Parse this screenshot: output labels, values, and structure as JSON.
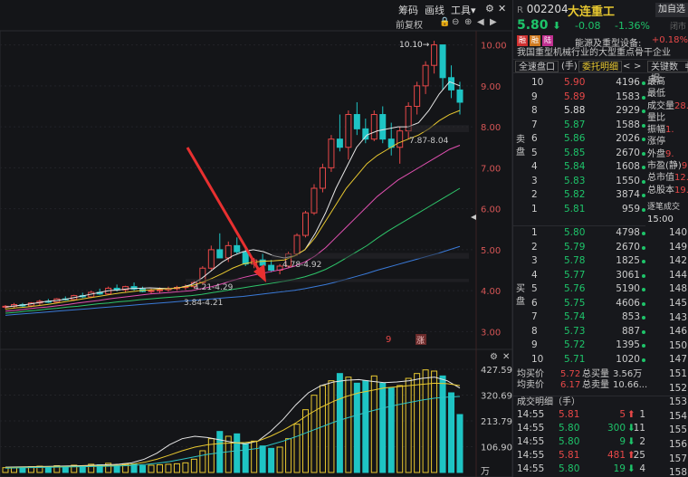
{
  "toolbar": {
    "chip_label": "筹码",
    "draw_label": "画线",
    "tools_label": "工具",
    "adjust_label": "前复权"
  },
  "chart_data": {
    "type": "candlestick",
    "price_ticks": [
      "10.00",
      "9.00",
      "8.00",
      "7.00",
      "6.00",
      "5.00",
      "4.00",
      "3.00"
    ],
    "price_range": [
      2.7,
      10.3
    ],
    "volume_ticks": [
      "427.59",
      "320.69",
      "213.79",
      "106.90",
      "万"
    ],
    "annotations": [
      "10.10→",
      "7.87-8.04",
      "4.78-4.92",
      "4.21-4.29",
      "3.84-4.21"
    ],
    "bottom_marks": [
      "9",
      "涨"
    ],
    "candles": [
      [
        3.6,
        3.65,
        3.55,
        3.62
      ],
      [
        3.62,
        3.7,
        3.58,
        3.66
      ],
      [
        3.66,
        3.7,
        3.6,
        3.63
      ],
      [
        3.63,
        3.72,
        3.6,
        3.7
      ],
      [
        3.7,
        3.78,
        3.65,
        3.74
      ],
      [
        3.74,
        3.8,
        3.7,
        3.72
      ],
      [
        3.72,
        3.82,
        3.7,
        3.8
      ],
      [
        3.8,
        3.86,
        3.76,
        3.78
      ],
      [
        3.78,
        3.9,
        3.75,
        3.88
      ],
      [
        3.88,
        3.95,
        3.82,
        3.85
      ],
      [
        3.85,
        4.0,
        3.82,
        3.96
      ],
      [
        3.96,
        4.05,
        3.9,
        3.92
      ],
      [
        3.92,
        4.1,
        3.9,
        4.06
      ],
      [
        4.06,
        4.15,
        3.98,
        4.02
      ],
      [
        4.02,
        4.12,
        3.95,
        4.1
      ],
      [
        4.1,
        4.2,
        4.0,
        4.04
      ],
      [
        4.04,
        4.1,
        3.96,
        3.98
      ],
      [
        3.98,
        4.05,
        3.92,
        4.0
      ],
      [
        4.0,
        4.08,
        3.95,
        4.02
      ],
      [
        4.02,
        4.1,
        3.98,
        4.05
      ],
      [
        4.05,
        4.12,
        4.0,
        4.08
      ],
      [
        4.08,
        4.15,
        4.02,
        4.1
      ],
      [
        4.1,
        4.25,
        4.05,
        4.2
      ],
      [
        4.2,
        4.6,
        4.15,
        4.55
      ],
      [
        4.55,
        5.1,
        4.5,
        5.0
      ],
      [
        5.0,
        5.4,
        4.9,
        4.8
      ],
      [
        4.8,
        5.2,
        4.7,
        5.1
      ],
      [
        5.1,
        5.3,
        4.9,
        4.95
      ],
      [
        4.95,
        5.05,
        4.6,
        4.65
      ],
      [
        4.65,
        4.8,
        4.55,
        4.75
      ],
      [
        4.75,
        4.9,
        4.6,
        4.62
      ],
      [
        4.62,
        4.75,
        4.45,
        4.5
      ],
      [
        4.5,
        4.65,
        4.4,
        4.6
      ],
      [
        4.6,
        4.95,
        4.55,
        4.9
      ],
      [
        4.9,
        5.4,
        4.85,
        5.35
      ],
      [
        5.35,
        5.95,
        5.3,
        5.9
      ],
      [
        5.9,
        6.6,
        5.85,
        6.5
      ],
      [
        6.5,
        7.1,
        6.4,
        7.0
      ],
      [
        7.0,
        7.8,
        6.9,
        7.7
      ],
      [
        7.7,
        8.3,
        7.4,
        7.5
      ],
      [
        7.5,
        8.4,
        7.2,
        8.3
      ],
      [
        8.3,
        8.6,
        7.8,
        7.95
      ],
      [
        7.95,
        8.2,
        7.6,
        7.7
      ],
      [
        7.7,
        8.4,
        7.65,
        8.3
      ],
      [
        8.3,
        8.5,
        7.6,
        7.7
      ],
      [
        7.7,
        8.1,
        7.3,
        7.5
      ],
      [
        7.5,
        8.0,
        7.1,
        7.9
      ],
      [
        7.9,
        8.6,
        7.7,
        8.5
      ],
      [
        8.5,
        9.1,
        8.3,
        9.0
      ],
      [
        9.0,
        9.6,
        8.8,
        9.5
      ],
      [
        9.5,
        10.1,
        9.3,
        10.0
      ],
      [
        10.0,
        10.0,
        8.9,
        9.2
      ],
      [
        9.2,
        9.5,
        8.7,
        8.9
      ],
      [
        8.9,
        9.1,
        8.3,
        8.6
      ]
    ],
    "ma_lines": [
      {
        "color": "#e6e6e6",
        "values": [
          3.6,
          3.63,
          3.66,
          3.7,
          3.74,
          3.76,
          3.8,
          3.85,
          3.9,
          3.95,
          4.0,
          4.02,
          4.05,
          4.06,
          4.07,
          4.06,
          4.05,
          4.08,
          4.15,
          4.3,
          4.5,
          4.7,
          4.85,
          4.95,
          5.0,
          4.95,
          4.85,
          4.8,
          4.85,
          5.0,
          5.4,
          5.9,
          6.5,
          7.0,
          7.5,
          7.8,
          7.9,
          7.95,
          8.0,
          8.0,
          8.1,
          8.4,
          8.8,
          9.1,
          9.0
        ]
      },
      {
        "color": "#e8c830",
        "values": [
          3.55,
          3.58,
          3.6,
          3.63,
          3.66,
          3.7,
          3.74,
          3.78,
          3.82,
          3.86,
          3.9,
          3.94,
          3.97,
          4.0,
          4.02,
          4.04,
          4.05,
          4.08,
          4.12,
          4.2,
          4.3,
          4.42,
          4.55,
          4.65,
          4.7,
          4.72,
          4.73,
          4.75,
          4.85,
          5.0,
          5.3,
          5.7,
          6.1,
          6.5,
          6.8,
          7.1,
          7.3,
          7.45,
          7.6,
          7.7,
          7.8,
          7.95,
          8.15,
          8.3,
          8.4
        ]
      },
      {
        "color": "#e050b0",
        "values": [
          3.5,
          3.52,
          3.55,
          3.58,
          3.6,
          3.63,
          3.66,
          3.7,
          3.73,
          3.76,
          3.8,
          3.83,
          3.86,
          3.89,
          3.92,
          3.94,
          3.96,
          3.98,
          4.0,
          4.05,
          4.1,
          4.17,
          4.25,
          4.32,
          4.38,
          4.43,
          4.48,
          4.53,
          4.6,
          4.7,
          4.85,
          5.05,
          5.3,
          5.55,
          5.8,
          6.05,
          6.3,
          6.5,
          6.7,
          6.85,
          7.0,
          7.15,
          7.3,
          7.45,
          7.55
        ]
      },
      {
        "color": "#2ec46a",
        "values": [
          3.45,
          3.47,
          3.5,
          3.52,
          3.55,
          3.57,
          3.6,
          3.62,
          3.65,
          3.68,
          3.7,
          3.73,
          3.75,
          3.78,
          3.8,
          3.82,
          3.84,
          3.86,
          3.88,
          3.91,
          3.95,
          3.99,
          4.03,
          4.07,
          4.11,
          4.15,
          4.19,
          4.23,
          4.28,
          4.34,
          4.42,
          4.52,
          4.65,
          4.8,
          4.95,
          5.1,
          5.28,
          5.45,
          5.6,
          5.75,
          5.9,
          6.05,
          6.2,
          6.35,
          6.5
        ]
      },
      {
        "color": "#3a7ad8",
        "values": [
          3.4,
          3.42,
          3.44,
          3.46,
          3.48,
          3.5,
          3.52,
          3.54,
          3.56,
          3.58,
          3.6,
          3.62,
          3.64,
          3.66,
          3.68,
          3.7,
          3.72,
          3.74,
          3.76,
          3.78,
          3.8,
          3.82,
          3.84,
          3.86,
          3.89,
          3.92,
          3.95,
          3.98,
          4.01,
          4.05,
          4.1,
          4.15,
          4.21,
          4.28,
          4.35,
          4.42,
          4.5,
          4.57,
          4.64,
          4.71,
          4.78,
          4.85,
          4.92,
          5.0,
          5.08
        ]
      }
    ],
    "volumes": [
      20,
      22,
      18,
      24,
      26,
      22,
      28,
      25,
      30,
      27,
      34,
      32,
      38,
      30,
      36,
      35,
      28,
      30,
      32,
      34,
      36,
      40,
      55,
      90,
      140,
      170,
      150,
      160,
      120,
      130,
      110,
      100,
      105,
      140,
      200,
      260,
      320,
      360,
      380,
      410,
      395,
      370,
      380,
      400,
      370,
      350,
      360,
      390,
      410,
      425,
      420,
      400,
      330,
      240
    ],
    "vol_ma": [
      {
        "color": "#e6e6e6",
        "values": [
          22,
          23,
          24,
          25,
          26,
          27,
          28,
          30,
          32,
          34,
          40,
          55,
          80,
          115,
          140,
          150,
          145,
          135,
          125,
          118,
          130,
          170,
          220,
          280,
          330,
          360,
          375,
          382,
          385,
          378,
          372,
          375,
          380,
          390,
          395,
          380,
          350
        ]
      },
      {
        "color": "#e8c830",
        "values": [
          20,
          21,
          22,
          23,
          24,
          25,
          26,
          27,
          28,
          30,
          34,
          42,
          55,
          72,
          90,
          105,
          115,
          120,
          122,
          124,
          130,
          150,
          175,
          205,
          240,
          270,
          295,
          315,
          330,
          340,
          350,
          355,
          360,
          365,
          370,
          368,
          360
        ]
      },
      {
        "color": "#2ec4c4",
        "values": [
          18,
          19,
          20,
          21,
          22,
          23,
          24,
          25,
          26,
          27,
          29,
          33,
          38,
          45,
          55,
          65,
          75,
          82,
          88,
          93,
          100,
          115,
          130,
          148,
          168,
          188,
          208,
          225,
          240,
          255,
          268,
          280,
          290,
          300,
          308,
          312,
          315
        ]
      }
    ]
  },
  "quote": {
    "r_label": "R",
    "code": "002204",
    "name": "大连重工",
    "add_label": "加自选",
    "price": "5.80",
    "arrow": "⬇",
    "change": "-0.08",
    "pct": "-1.36%",
    "status": "闭市",
    "tags": [
      "融",
      "融",
      "陆"
    ],
    "industry": "能源及重型设备:",
    "industry_change": "+0.18%",
    "desc": "我国重型机械行业的大型重点骨干企业",
    "tabs": [
      "全速盘口",
      "(手)",
      "委托明细",
      "<",
      ">",
      "关键数据",
      "≡"
    ],
    "sell_label": "卖盘",
    "buy_label": "买盘",
    "asks": [
      {
        "lv": "10",
        "p": "5.90",
        "v": "4196"
      },
      {
        "lv": "9",
        "p": "5.89",
        "v": "1583"
      },
      {
        "lv": "8",
        "p": "5.88",
        "v": "2929"
      },
      {
        "lv": "7",
        "p": "5.87",
        "v": "1588"
      },
      {
        "lv": "6",
        "p": "5.86",
        "v": "2026"
      },
      {
        "lv": "5",
        "p": "5.85",
        "v": "2670"
      },
      {
        "lv": "4",
        "p": "5.84",
        "v": "1608"
      },
      {
        "lv": "3",
        "p": "5.83",
        "v": "1550"
      },
      {
        "lv": "2",
        "p": "5.82",
        "v": "3874"
      },
      {
        "lv": "1",
        "p": "5.81",
        "v": "959"
      }
    ],
    "bids": [
      {
        "lv": "1",
        "p": "5.80",
        "v": "4798"
      },
      {
        "lv": "2",
        "p": "5.79",
        "v": "2670"
      },
      {
        "lv": "3",
        "p": "5.78",
        "v": "1825"
      },
      {
        "lv": "4",
        "p": "5.77",
        "v": "3061"
      },
      {
        "lv": "5",
        "p": "5.76",
        "v": "5190"
      },
      {
        "lv": "6",
        "p": "5.75",
        "v": "4606"
      },
      {
        "lv": "7",
        "p": "5.74",
        "v": "853"
      },
      {
        "lv": "8",
        "p": "5.73",
        "v": "887"
      },
      {
        "lv": "9",
        "p": "5.72",
        "v": "1395"
      },
      {
        "lv": "10",
        "p": "5.71",
        "v": "1020"
      }
    ],
    "stats": [
      {
        "k": "最高",
        "v": ""
      },
      {
        "k": "最低",
        "v": ""
      },
      {
        "k": "成交量",
        "v": "28."
      },
      {
        "k": "量比",
        "v": ""
      },
      {
        "k": "振幅",
        "v": "1."
      },
      {
        "k": "涨停",
        "v": ""
      },
      {
        "k": "外盘",
        "v": "9."
      },
      {
        "k": "市盈(静)",
        "v": "9"
      },
      {
        "k": "总市值",
        "v": "12."
      },
      {
        "k": "总股本",
        "v": "19."
      }
    ],
    "tick_header": "逐笔成交",
    "tick_time": "15:00",
    "ticks": [
      "140",
      "149",
      "142",
      "144",
      "148",
      "145",
      "143",
      "146",
      "150",
      "147",
      "151",
      "152",
      "153",
      "154",
      "155",
      "156",
      "157",
      "158"
    ],
    "avg_buy_label": "均买价",
    "avg_buy": "5.72",
    "total_buy_label": "总买量",
    "total_buy": "3.56万",
    "avg_sell_label": "均卖价",
    "avg_sell": "6.17",
    "total_sell_label": "总卖量",
    "total_sell": "10.66...",
    "trades_header": "成交明细（手）",
    "trades": [
      {
        "t": "14:55",
        "p": "5.81",
        "v": "5",
        "a": "⬆",
        "n": "1",
        "c": "#e84848"
      },
      {
        "t": "14:55",
        "p": "5.80",
        "v": "300",
        "a": "⬇",
        "n": "11",
        "c": "#1ec46a"
      },
      {
        "t": "14:55",
        "p": "5.80",
        "v": "9",
        "a": "⬇",
        "n": "2",
        "c": "#1ec46a"
      },
      {
        "t": "14:55",
        "p": "5.81",
        "v": "481",
        "a": "⬆",
        "n": "25",
        "c": "#e84848"
      },
      {
        "t": "14:55",
        "p": "5.80",
        "v": "19",
        "a": "⬇",
        "n": "4",
        "c": "#1ec46a"
      }
    ]
  },
  "colors": {
    "up": "#e84848",
    "down": "#1ec4c4",
    "green": "#1ec46a",
    "arrow": "#e83030"
  }
}
